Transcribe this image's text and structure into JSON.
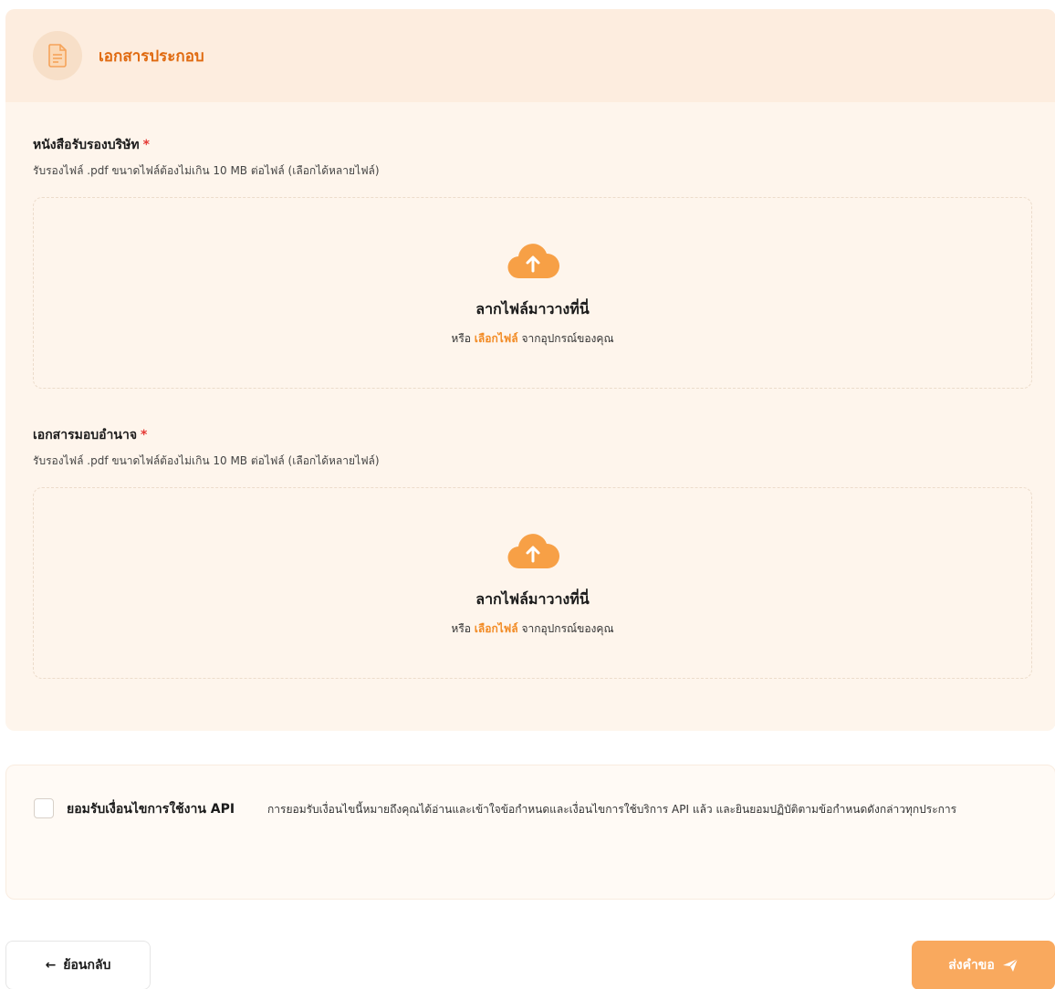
{
  "header": {
    "title": "เอกสารประกอบ",
    "icon": "document-icon"
  },
  "sections": [
    {
      "label": "หนังสือรับรองบริษัท",
      "required_mark": "*",
      "hint": "รับรองไฟล์ .pdf ขนาดไฟล์ต้องไม่เกิน 10 MB ต่อไฟล์ (เลือกได้หลายไฟล์)",
      "dropzone": {
        "icon": "cloud-upload-icon",
        "title": "ลากไฟล์มาวางที่นี่",
        "prefix": "หรือ",
        "link": "เลือกไฟล์",
        "suffix": "จากอุปกรณ์ของคุณ"
      }
    },
    {
      "label": "เอกสารมอบอำนาจ",
      "required_mark": "*",
      "hint": "รับรองไฟล์ .pdf ขนาดไฟล์ต้องไม่เกิน 10 MB ต่อไฟล์ (เลือกได้หลายไฟล์)",
      "dropzone": {
        "icon": "cloud-upload-icon",
        "title": "ลากไฟล์มาวางที่นี่",
        "prefix": "หรือ",
        "link": "เลือกไฟล์",
        "suffix": "จากอุปกรณ์ของคุณ"
      }
    }
  ],
  "terms": {
    "checked": false,
    "label": "ยอมรับเงื่อนไขการใช้งาน API",
    "description": "การยอมรับเงื่อนไขนี้หมายถึงคุณได้อ่านและเข้าใจข้อกำหนดและเงื่อนไขการใช้บริการ API แล้ว และยินยอมปฏิบัติตามข้อกำหนดดังกล่าวทุกประการ"
  },
  "actions": {
    "back_arrow": "←",
    "back_label": "ย้อนกลับ",
    "submit_label": "ส่งคำขอ",
    "submit_icon": "send-icon"
  },
  "colors": {
    "accent": "#f28a23",
    "header_text": "#e06a10",
    "required": "#e53935",
    "card_bg": "#fef5ec",
    "submit_bg": "#f9a95e"
  }
}
